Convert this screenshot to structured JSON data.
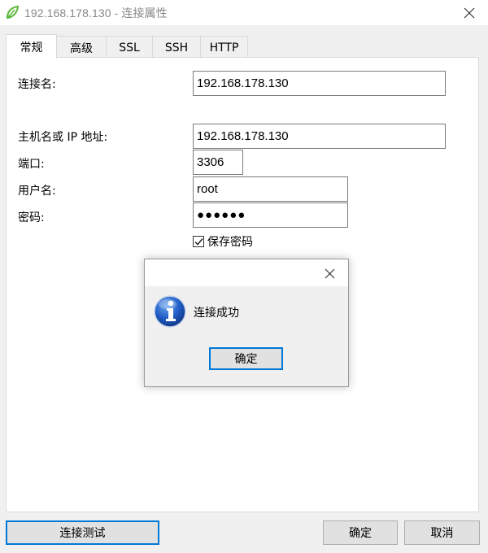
{
  "window": {
    "title": "192.168.178.130 - 连接属性"
  },
  "tabs": [
    {
      "label": "常规",
      "active": true
    },
    {
      "label": "高级",
      "active": false
    },
    {
      "label": "SSL",
      "active": false
    },
    {
      "label": "SSH",
      "active": false
    },
    {
      "label": "HTTP",
      "active": false
    }
  ],
  "form": {
    "connection_name_label": "连接名:",
    "connection_name_value": "192.168.178.130",
    "host_label": "主机名或 IP 地址:",
    "host_value": "192.168.178.130",
    "port_label": "端口:",
    "port_value": "3306",
    "username_label": "用户名:",
    "username_value": "root",
    "password_label": "密码:",
    "password_value": "●●●●●●",
    "save_password_label": "保存密码",
    "save_password_checked": true
  },
  "buttons": {
    "test_connection": "连接测试",
    "ok": "确定",
    "cancel": "取消"
  },
  "message_box": {
    "text": "连接成功",
    "ok_label": "确定"
  },
  "colors": {
    "accent": "#0078d7",
    "app_icon": "#5cb83a",
    "info_icon": "#1f5cc4"
  }
}
